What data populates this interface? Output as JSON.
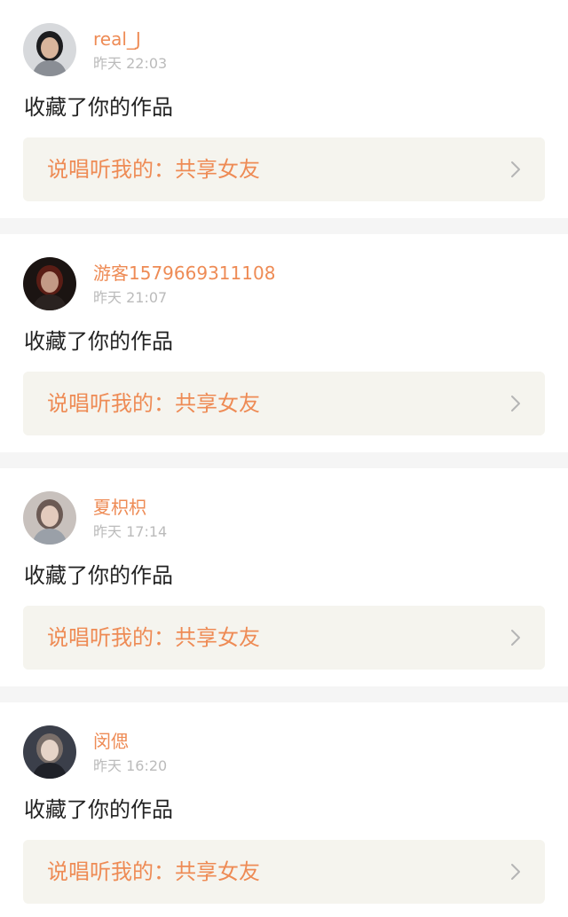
{
  "theme": {
    "accent": "#ee8b55",
    "timestamp_color": "#bbbbbb",
    "link_bg": "#f5f4ee",
    "chevron_color": "#b5b5b5"
  },
  "notifications": [
    {
      "username": "real_J",
      "timestamp": "昨天 22:03",
      "action": "收藏了你的作品",
      "work_title": "说唱听我的：共享女友",
      "avatar_icon": "user-avatar-icon",
      "avatar_colors": [
        "#d7d9dc",
        "#1d1d1f",
        "#d9b59c",
        "#8a8e95"
      ]
    },
    {
      "username": "游客1579669311108",
      "timestamp": "昨天 21:07",
      "action": "收藏了你的作品",
      "work_title": "说唱听我的：共享女友",
      "avatar_icon": "user-avatar-icon",
      "avatar_colors": [
        "#1b1412",
        "#5a1d15",
        "#c39a86",
        "#2a2220"
      ]
    },
    {
      "username": "夏枳枳",
      "timestamp": "昨天 17:14",
      "action": "收藏了你的作品",
      "work_title": "说唱听我的：共享女友",
      "avatar_icon": "user-avatar-icon",
      "avatar_colors": [
        "#c8c1bd",
        "#6b5a54",
        "#e3cbbd",
        "#9aa0a8"
      ]
    },
    {
      "username": "闵偲",
      "timestamp": "昨天 16:20",
      "action": "收藏了你的作品",
      "work_title": "说唱听我的：共享女友",
      "avatar_icon": "user-avatar-icon",
      "avatar_colors": [
        "#3b3f4a",
        "#7a6f6a",
        "#e6d4c8",
        "#1f2128"
      ]
    }
  ]
}
